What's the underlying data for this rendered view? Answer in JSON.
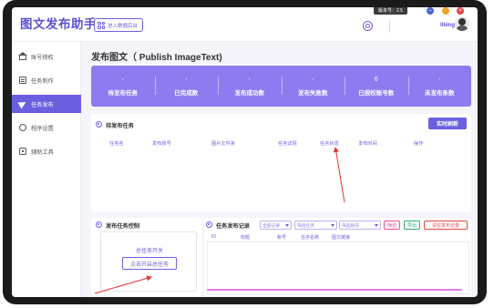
{
  "app": {
    "title": "图文发布助手",
    "enter_backend_label": "进入数据后台",
    "version": "版本号：2.5",
    "username": "llbing1"
  },
  "sidebar": {
    "items": [
      {
        "label": "账号授权",
        "icon": "home-icon",
        "active": false
      },
      {
        "label": "任务制作",
        "icon": "list-icon",
        "active": false
      },
      {
        "label": "任务发布",
        "icon": "send-icon",
        "active": true
      },
      {
        "label": "程序设置",
        "icon": "gear-icon",
        "active": false
      },
      {
        "label": "辅助工具",
        "icon": "tool-icon",
        "active": false
      }
    ]
  },
  "main": {
    "page_title": "发布图文（ Publish ImageText)",
    "stats": [
      {
        "value": "-",
        "label": "待发布任务"
      },
      {
        "value": "-",
        "label": "已完成数"
      },
      {
        "value": "-",
        "label": "发布成功数"
      },
      {
        "value": "-",
        "label": "发布失败数"
      },
      {
        "value": "6",
        "label": "已授权账号数"
      },
      {
        "value": "-",
        "label": "未发布条数"
      }
    ],
    "pending": {
      "title": "待发布任务",
      "refresh_label": "实时刷新",
      "columns": [
        "任务名",
        "发布账号",
        "图片文件夹",
        "任务详情",
        "任务状态",
        "发布时间",
        "操作"
      ]
    },
    "control": {
      "title": "发布任务控制",
      "switch_label": "总任务开关",
      "start_label": "点击开启总任务"
    },
    "log": {
      "title": "任务发布记录",
      "filters": [
        "全部记录",
        "筛选任务",
        "筛选账号"
      ],
      "filter_btn": "筛选",
      "export_btn": "导出",
      "clear_btn": "清空发布记录",
      "columns": [
        "ID",
        "标题",
        "账号",
        "任务名称",
        "图文链接"
      ]
    }
  },
  "colors": {
    "accent": "#6b5fe0",
    "stats_bg": "#8f7bf0",
    "annotation_arrow": "#e53030"
  }
}
